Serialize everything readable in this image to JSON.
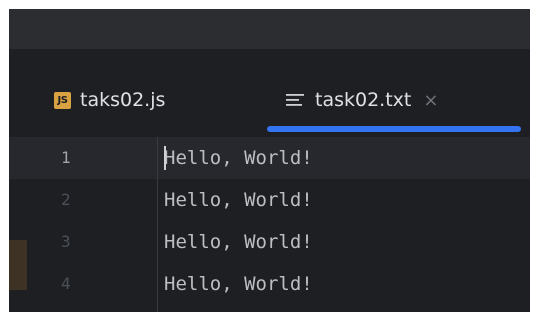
{
  "tabs": [
    {
      "label": "taks02.js",
      "icon": "js-file-icon",
      "icon_text": "JS",
      "active": false
    },
    {
      "label": "task02.txt",
      "icon": "text-file-icon",
      "active": true
    }
  ],
  "close_symbol": "×",
  "editor": {
    "lines": [
      {
        "number": "1",
        "text": "Hello, World!"
      },
      {
        "number": "2",
        "text": "Hello, World!"
      },
      {
        "number": "3",
        "text": "Hello, World!"
      },
      {
        "number": "4",
        "text": "Hello, World!"
      }
    ],
    "current_line": "1"
  },
  "colors": {
    "editor_bg": "#1e1f22",
    "accent": "#3574f0",
    "js_icon": "#d9a343"
  }
}
